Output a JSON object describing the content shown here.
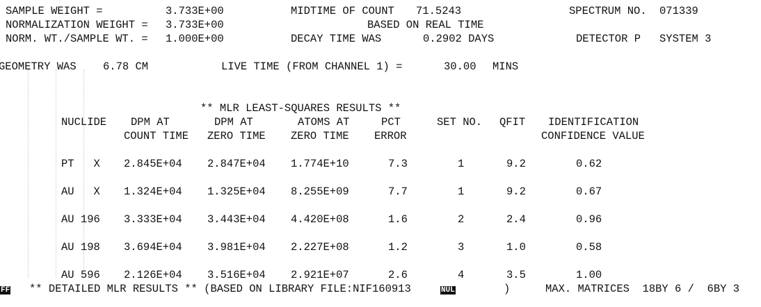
{
  "header": {
    "sample_weight_label": "SAMPLE WEIGHT =",
    "sample_weight_value": "3.733E+00",
    "midtime_label": "MIDTIME OF COUNT",
    "midtime_value": "71.5243",
    "spectrum_label": "SPECTRUM NO.",
    "spectrum_value": "071339",
    "norm_weight_label": "NORMALIZATION WEIGHT =",
    "norm_weight_value": "3.733E+00",
    "based_on": "BASED ON REAL TIME",
    "norm_ratio_label": "NORM. WT./SAMPLE WT. =",
    "norm_ratio_value": "1.000E+00",
    "decay_label": "DECAY TIME WAS",
    "decay_value": "0.2902 DAYS",
    "detector": "DETECTOR P",
    "system": "SYSTEM 3",
    "geometry_label": "GEOMETRY WAS",
    "geometry_value": "6.78 CM",
    "live_time_label": "LIVE TIME (FROM CHANNEL 1) =",
    "live_time_value": "30.00",
    "live_time_unit": "MINS"
  },
  "results": {
    "title": "** MLR LEAST-SQUARES RESULTS **",
    "headers": {
      "nuclide": "NUCLIDE",
      "dpm_count_1": "DPM AT",
      "dpm_count_2": "COUNT TIME",
      "dpm_zero_1": "DPM AT",
      "dpm_zero_2": "ZERO TIME",
      "atoms_1": "ATOMS AT",
      "atoms_2": "ZERO TIME",
      "pct_1": "PCT",
      "pct_2": "ERROR",
      "set_no": "SET NO.",
      "qfit": "QFIT",
      "ident_1": "IDENTIFICATION",
      "ident_2": "CONFIDENCE VALUE"
    },
    "rows": [
      {
        "nuclide": "PT   X",
        "dpm_count": "2.845E+04",
        "dpm_zero": "2.847E+04",
        "atoms": "1.774E+10",
        "pct": "7.3",
        "set": "1",
        "qfit": "9.2",
        "conf": "0.62"
      },
      {
        "nuclide": "AU   X",
        "dpm_count": "1.324E+04",
        "dpm_zero": "1.325E+04",
        "atoms": "8.255E+09",
        "pct": "7.7",
        "set": "1",
        "qfit": "9.2",
        "conf": "0.67"
      },
      {
        "nuclide": "AU 196",
        "dpm_count": "3.333E+04",
        "dpm_zero": "3.443E+04",
        "atoms": "4.420E+08",
        "pct": "1.6",
        "set": "2",
        "qfit": "2.4",
        "conf": "0.96"
      },
      {
        "nuclide": "AU 198",
        "dpm_count": "3.694E+04",
        "dpm_zero": "3.981E+04",
        "atoms": "2.227E+08",
        "pct": "1.2",
        "set": "3",
        "qfit": "1.0",
        "conf": "0.58"
      },
      {
        "nuclide": "AU 596",
        "dpm_count": "2.126E+04",
        "dpm_zero": "3.516E+04",
        "atoms": "2.921E+07",
        "pct": "2.6",
        "set": "4",
        "qfit": "3.5",
        "conf": "1.00"
      }
    ]
  },
  "footer": {
    "ff_glyph": "FF",
    "detail_text": "** DETAILED MLR RESULTS ** (BASED ON LIBRARY FILE:NIF160913",
    "nul_glyph": "NUL",
    "close_paren": ")",
    "matrices": "MAX. MATRICES  18BY 6 /  6BY 3"
  }
}
